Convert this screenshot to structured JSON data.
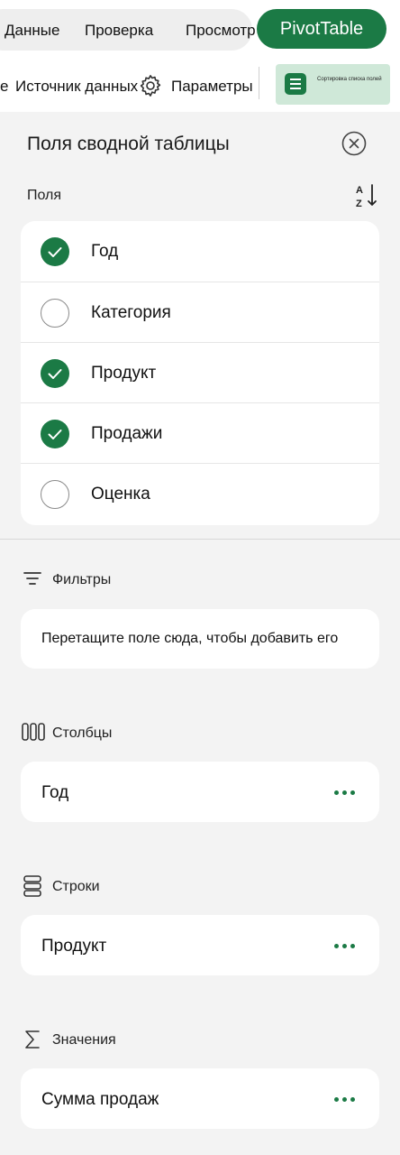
{
  "ribbon": {
    "tabs": [
      {
        "label": "Данные"
      },
      {
        "label": "Проверка"
      },
      {
        "label": "Просмотр"
      }
    ],
    "active_tab": "PivotTable",
    "toolbar": {
      "cut_label": "е",
      "source_label": "Источник данных",
      "settings_label": "Параметры",
      "sort_chip_label": "Сортировка списка полей"
    },
    "accent_color": "#1b7a45"
  },
  "pane": {
    "title": "Поля сводной таблицы",
    "fields_label": "Поля",
    "fields": [
      {
        "name": "Год",
        "checked": true
      },
      {
        "name": "Категория",
        "checked": false
      },
      {
        "name": "Продукт",
        "checked": true
      },
      {
        "name": "Продажи",
        "checked": true
      },
      {
        "name": "Оценка",
        "checked": false
      }
    ],
    "filters": {
      "label": "Фильтры",
      "placeholder": "Перетащите поле сюда, чтобы добавить его"
    },
    "columns": {
      "label": "Столбцы",
      "item": "Год"
    },
    "rows": {
      "label": "Строки",
      "item": "Продукт"
    },
    "values": {
      "label": "Значения",
      "item": "Сумма продаж"
    }
  }
}
